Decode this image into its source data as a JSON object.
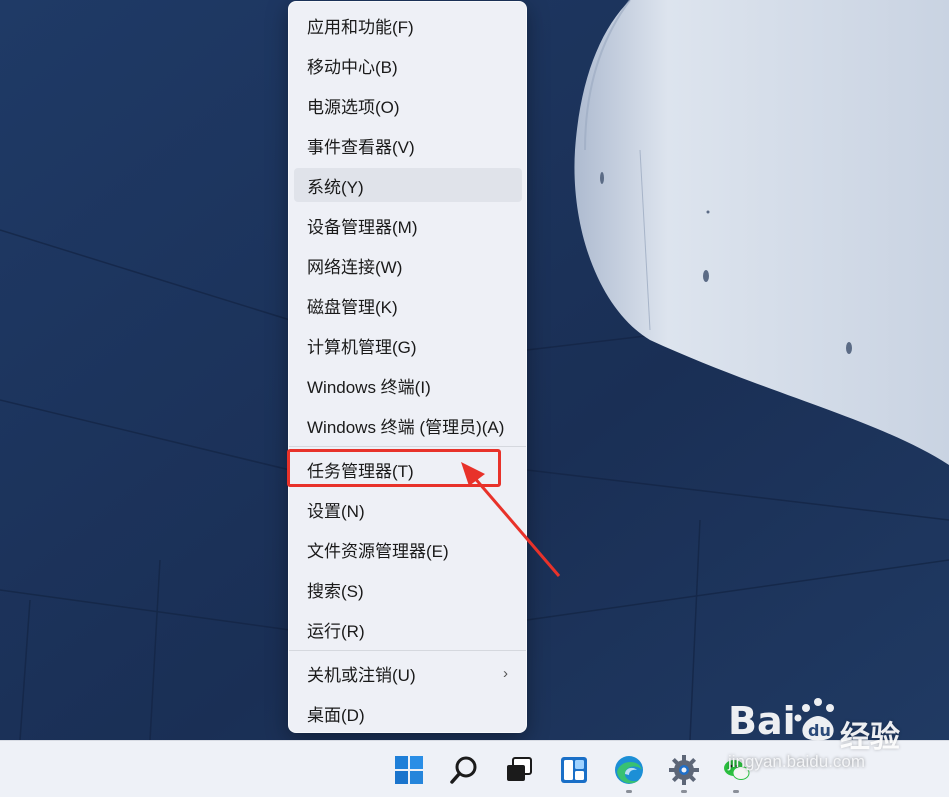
{
  "menu": {
    "items": [
      {
        "label": "应用和功能(F)"
      },
      {
        "label": "移动中心(B)"
      },
      {
        "label": "电源选项(O)"
      },
      {
        "label": "事件查看器(V)"
      },
      {
        "label": "系统(Y)"
      },
      {
        "label": "设备管理器(M)"
      },
      {
        "label": "网络连接(W)"
      },
      {
        "label": "磁盘管理(K)"
      },
      {
        "label": "计算机管理(G)"
      },
      {
        "label": "Windows 终端(I)"
      },
      {
        "label": "Windows 终端 (管理员)(A)"
      },
      {
        "label": "任务管理器(T)"
      },
      {
        "label": "设置(N)"
      },
      {
        "label": "文件资源管理器(E)"
      },
      {
        "label": "搜索(S)"
      },
      {
        "label": "运行(R)"
      },
      {
        "label": "关机或注销(U)"
      },
      {
        "label": "桌面(D)"
      }
    ],
    "hovered_item": "系统(Y)",
    "highlighted_item": "任务管理器(T)",
    "submenu_chevron": "›"
  },
  "taskbar": {
    "icons": [
      "windows-start-icon",
      "search-icon",
      "task-view-icon",
      "widgets-icon",
      "edge-browser-icon",
      "settings-gear-icon",
      "wechat-icon"
    ]
  },
  "watermark": {
    "brand": "经验",
    "url": "jingyan.baidu.com"
  },
  "colors": {
    "annotation_red": "#e8322a",
    "menu_background": "#eef0f6",
    "desktop_blue": "#1d3258"
  }
}
